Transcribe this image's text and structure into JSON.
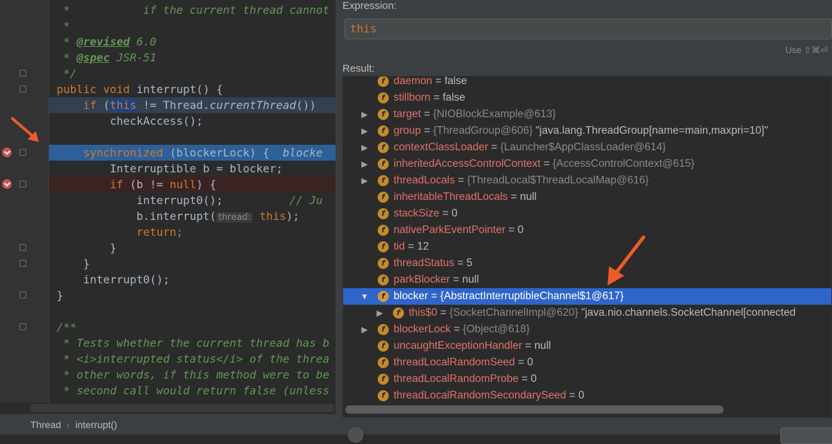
{
  "editor": {
    "lines": [
      {
        "id": "l1",
        "parts": [
          {
            "t": " *           ",
            "c": "cm"
          },
          {
            "t": "if the current thread cannot",
            "c": "cm"
          }
        ]
      },
      {
        "id": "l2",
        "parts": [
          {
            "t": " *",
            "c": "cm"
          }
        ]
      },
      {
        "id": "l3",
        "parts": [
          {
            "t": " * ",
            "c": "cm"
          },
          {
            "t": "@revised",
            "c": "tagb"
          },
          {
            "t": " 6.0",
            "c": "cm"
          }
        ]
      },
      {
        "id": "l4",
        "parts": [
          {
            "t": " * ",
            "c": "cm"
          },
          {
            "t": "@spec",
            "c": "tagb"
          },
          {
            "t": " JSR-51",
            "c": "cm"
          }
        ]
      },
      {
        "id": "l5",
        "parts": [
          {
            "t": " */",
            "c": "cm"
          }
        ]
      },
      {
        "id": "l6",
        "parts": [
          {
            "t": "public ",
            "c": "kw"
          },
          {
            "t": "void ",
            "c": "kw"
          },
          {
            "t": "interrupt() {",
            "c": ""
          }
        ]
      },
      {
        "id": "l7",
        "parts": [
          {
            "t": "    if ",
            "c": "kw"
          },
          {
            "t": "(",
            "c": ""
          },
          {
            "t": "this",
            "c": "kw this-hl"
          },
          {
            "t": " != Thread.",
            "c": ""
          },
          {
            "t": "currentThread",
            "c": "it"
          },
          {
            "t": "())",
            "c": ""
          }
        ]
      },
      {
        "id": "l8",
        "parts": [
          {
            "t": "        checkAccess();",
            "c": ""
          }
        ]
      },
      {
        "id": "l9",
        "parts": [
          {
            "t": "",
            "c": ""
          }
        ]
      },
      {
        "id": "l10",
        "parts": [
          {
            "t": "    synchronized ",
            "c": "kw"
          },
          {
            "t": "(blockerLock) {  ",
            "c": ""
          },
          {
            "t": "blocke",
            "c": "it"
          }
        ]
      },
      {
        "id": "l11",
        "parts": [
          {
            "t": "        Interruptible b = blocker;",
            "c": ""
          }
        ]
      },
      {
        "id": "l12",
        "parts": [
          {
            "t": "        if ",
            "c": "kw"
          },
          {
            "t": "(b != ",
            "c": ""
          },
          {
            "t": "null",
            "c": "kw"
          },
          {
            "t": ") {",
            "c": ""
          }
        ]
      },
      {
        "id": "l13",
        "parts": [
          {
            "t": "            interrupt0();          ",
            "c": ""
          },
          {
            "t": "// Ju",
            "c": "cm"
          }
        ]
      },
      {
        "id": "l14",
        "parts": [
          {
            "t": "            b.interrupt(",
            "c": ""
          },
          {
            "t": "thread:",
            "c": "inlay"
          },
          {
            "t": " this",
            "c": "kw"
          },
          {
            "t": ");",
            "c": ""
          }
        ]
      },
      {
        "id": "l15",
        "parts": [
          {
            "t": "            return;",
            "c": "kw"
          }
        ]
      },
      {
        "id": "l16",
        "parts": [
          {
            "t": "        }",
            "c": ""
          }
        ]
      },
      {
        "id": "l17",
        "parts": [
          {
            "t": "    }",
            "c": ""
          }
        ]
      },
      {
        "id": "l18",
        "parts": [
          {
            "t": "    interrupt0();",
            "c": ""
          }
        ]
      },
      {
        "id": "l19",
        "parts": [
          {
            "t": "}",
            "c": ""
          }
        ]
      },
      {
        "id": "l20",
        "parts": [
          {
            "t": "",
            "c": ""
          }
        ]
      },
      {
        "id": "l21",
        "parts": [
          {
            "t": "/**",
            "c": "cm"
          }
        ]
      },
      {
        "id": "l22",
        "parts": [
          {
            "t": " * Tests whether the current thread has b",
            "c": "cm"
          }
        ]
      },
      {
        "id": "l23",
        "parts": [
          {
            "t": " * <i>interrupted status</i> of the threa",
            "c": "cm"
          }
        ]
      },
      {
        "id": "l24",
        "parts": [
          {
            "t": " * other words, if this method were to be",
            "c": "cm"
          }
        ]
      },
      {
        "id": "l25",
        "parts": [
          {
            "t": " * second call would return false (unless",
            "c": "cm"
          }
        ]
      }
    ]
  },
  "breadcrumb": {
    "class": "Thread",
    "method": "interrupt()"
  },
  "dialog": {
    "expression_label": "Expression:",
    "expression_value": "this",
    "shortcut": "Use ⇧⌘⏎",
    "result_label": "Result:",
    "tree": [
      {
        "exp": "",
        "depth": 0,
        "name": "daemon",
        "eq": " = ",
        "type": "",
        "val": "false"
      },
      {
        "exp": "",
        "depth": 0,
        "name": "stillborn",
        "eq": " = ",
        "type": "",
        "val": "false"
      },
      {
        "exp": "▶",
        "depth": 0,
        "name": "target",
        "eq": " = ",
        "type": "{NIOBlockExample@613}",
        "val": ""
      },
      {
        "exp": "▶",
        "depth": 0,
        "name": "group",
        "eq": " = ",
        "type": "{ThreadGroup@606}",
        "val": " \"java.lang.ThreadGroup[name=main,maxpri=10]\""
      },
      {
        "exp": "▶",
        "depth": 0,
        "name": "contextClassLoader",
        "eq": " = ",
        "type": "{Launcher$AppClassLoader@614}",
        "val": ""
      },
      {
        "exp": "▶",
        "depth": 0,
        "name": "inheritedAccessControlContext",
        "eq": " = ",
        "type": "{AccessControlContext@615}",
        "val": ""
      },
      {
        "exp": "▶",
        "depth": 0,
        "name": "threadLocals",
        "eq": " = ",
        "type": "{ThreadLocal$ThreadLocalMap@616}",
        "val": ""
      },
      {
        "exp": "",
        "depth": 0,
        "name": "inheritableThreadLocals",
        "eq": " = ",
        "type": "",
        "val": "null"
      },
      {
        "exp": "",
        "depth": 0,
        "name": "stackSize",
        "eq": " = ",
        "type": "",
        "val": "0"
      },
      {
        "exp": "",
        "depth": 0,
        "name": "nativeParkEventPointer",
        "eq": " = ",
        "type": "",
        "val": "0"
      },
      {
        "exp": "",
        "depth": 0,
        "name": "tid",
        "eq": " = ",
        "type": "",
        "val": "12"
      },
      {
        "exp": "",
        "depth": 0,
        "name": "threadStatus",
        "eq": " = ",
        "type": "",
        "val": "5"
      },
      {
        "exp": "",
        "depth": 0,
        "name": "parkBlocker",
        "eq": " = ",
        "type": "",
        "val": "null"
      },
      {
        "exp": "▼",
        "depth": 0,
        "name": "blocker",
        "eq": " = ",
        "type": "{AbstractInterruptibleChannel$1@617}",
        "val": "",
        "selected": true
      },
      {
        "exp": "▶",
        "depth": 1,
        "name": "this$0",
        "eq": " = ",
        "type": "{SocketChannelImpl@620}",
        "val": " \"java.nio.channels.SocketChannel[connected"
      },
      {
        "exp": "▶",
        "depth": 0,
        "name": "blockerLock",
        "eq": " = ",
        "type": "{Object@618}",
        "val": ""
      },
      {
        "exp": "",
        "depth": 0,
        "name": "uncaughtExceptionHandler",
        "eq": " = ",
        "type": "",
        "val": "null"
      },
      {
        "exp": "",
        "depth": 0,
        "name": "threadLocalRandomSeed",
        "eq": " = ",
        "type": "",
        "val": "0"
      },
      {
        "exp": "",
        "depth": 0,
        "name": "threadLocalRandomProbe",
        "eq": " = ",
        "type": "",
        "val": "0"
      },
      {
        "exp": "",
        "depth": 0,
        "name": "threadLocalRandomSecondarySeed",
        "eq": " = ",
        "type": "",
        "val": "0"
      }
    ],
    "field_icon_letter": "f"
  },
  "colors": {
    "keyword": "#cc7832",
    "comment": "#629755",
    "field": "#e0726a",
    "selection": "#2f65ca",
    "arrow": "#f05a28"
  }
}
